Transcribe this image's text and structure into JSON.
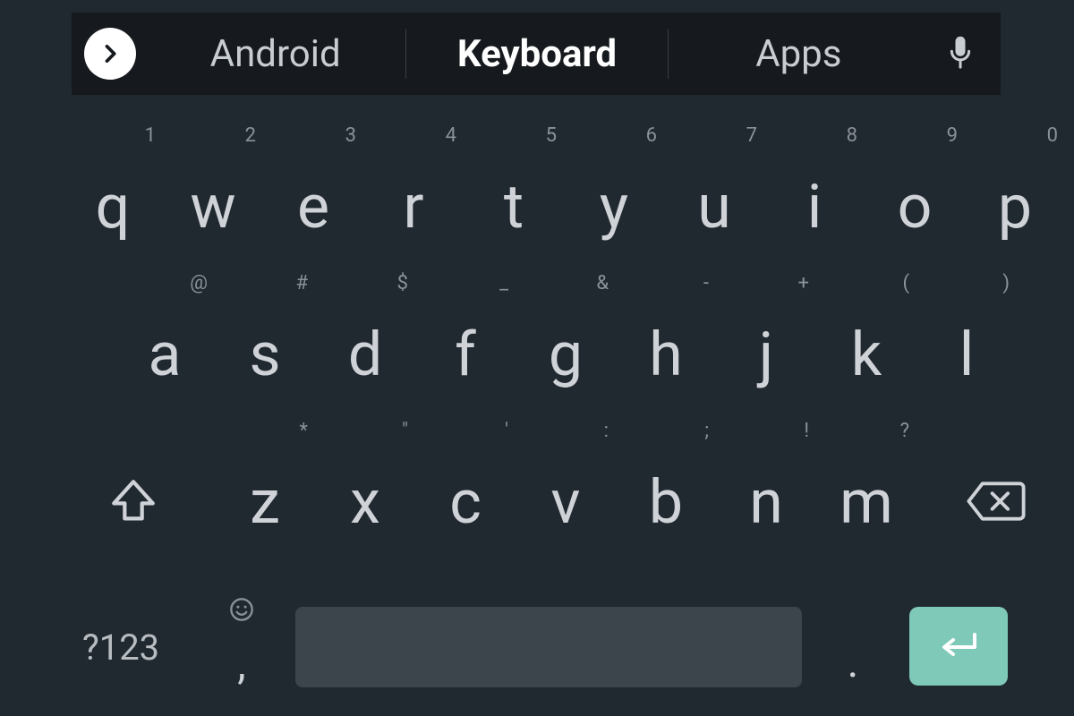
{
  "suggestion_bar": {
    "items": [
      "Android",
      "Keyboard",
      "Apps"
    ],
    "selected_index": 1
  },
  "rows": {
    "row1": [
      {
        "main": "q",
        "hint": "1"
      },
      {
        "main": "w",
        "hint": "2"
      },
      {
        "main": "e",
        "hint": "3"
      },
      {
        "main": "r",
        "hint": "4"
      },
      {
        "main": "t",
        "hint": "5"
      },
      {
        "main": "y",
        "hint": "6"
      },
      {
        "main": "u",
        "hint": "7"
      },
      {
        "main": "i",
        "hint": "8"
      },
      {
        "main": "o",
        "hint": "9"
      },
      {
        "main": "p",
        "hint": "0"
      }
    ],
    "row2": [
      {
        "main": "a",
        "hint": "@"
      },
      {
        "main": "s",
        "hint": "#"
      },
      {
        "main": "d",
        "hint": "$"
      },
      {
        "main": "f",
        "hint": "_"
      },
      {
        "main": "g",
        "hint": "&"
      },
      {
        "main": "h",
        "hint": "-"
      },
      {
        "main": "j",
        "hint": "+"
      },
      {
        "main": "k",
        "hint": "("
      },
      {
        "main": "l",
        "hint": ")"
      }
    ],
    "row3": [
      {
        "main": "z",
        "hint": "*"
      },
      {
        "main": "x",
        "hint": "\""
      },
      {
        "main": "c",
        "hint": "'"
      },
      {
        "main": "v",
        "hint": ":"
      },
      {
        "main": "b",
        "hint": ";"
      },
      {
        "main": "n",
        "hint": "!"
      },
      {
        "main": "m",
        "hint": "?"
      }
    ]
  },
  "bottom": {
    "symbols_label": "?123",
    "comma": ",",
    "period": "."
  },
  "icons": {
    "expand": "chevron-right-icon",
    "mic": "microphone-icon",
    "shift": "shift-icon",
    "backspace": "backspace-icon",
    "emoji": "emoji-icon",
    "enter": "enter-icon"
  },
  "colors": {
    "bg": "#202830",
    "bar_bg": "#16191d",
    "key_text": "#cfd3d7",
    "hint_text": "#8a9198",
    "spacebar_bg": "#3d454c",
    "enter_bg": "#7ec9b8"
  }
}
